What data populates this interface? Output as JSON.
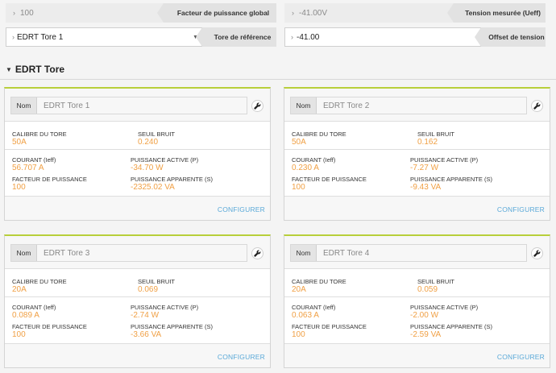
{
  "top": {
    "power_factor_value": "100",
    "power_factor_label": "Facteur de puissance global",
    "voltage_value": "-41.00V",
    "voltage_label": "Tension mesurée (Ueff)",
    "ref_tore_value": "EDRT Tore 1",
    "ref_tore_label": "Tore de référence",
    "offset_value": "-41.00",
    "offset_label": "Offset de tension"
  },
  "section": {
    "title": "EDRT Tore"
  },
  "labels": {
    "name_tag": "Nom",
    "calibre": "CALIBRE DU TORE",
    "noise": "SEUIL BRUIT",
    "current": "COURANT (Ieff)",
    "active": "PUISSANCE ACTIVE (P)",
    "pf": "FACTEUR DE PUISSANCE",
    "apparent": "PUISSANCE APPARENTE (S)",
    "configure": "CONFIGURER"
  },
  "cards": [
    {
      "name": "EDRT Tore 1",
      "calibre": "50A",
      "noise": "0.240",
      "current": "56.707 A",
      "active": "-34.70 W",
      "pf": "100",
      "apparent": "-2325.02 VA"
    },
    {
      "name": "EDRT Tore 2",
      "calibre": "50A",
      "noise": "0.162",
      "current": "0.230 A",
      "active": "-7.27 W",
      "pf": "100",
      "apparent": "-9.43 VA"
    },
    {
      "name": "EDRT Tore 3",
      "calibre": "20A",
      "noise": "0.069",
      "current": "0.089 A",
      "active": "-2.74 W",
      "pf": "100",
      "apparent": "-3.66 VA"
    },
    {
      "name": "EDRT Tore 4",
      "calibre": "20A",
      "noise": "0.059",
      "current": "0.063 A",
      "active": "-2.00 W",
      "pf": "100",
      "apparent": "-2.59 VA"
    }
  ]
}
